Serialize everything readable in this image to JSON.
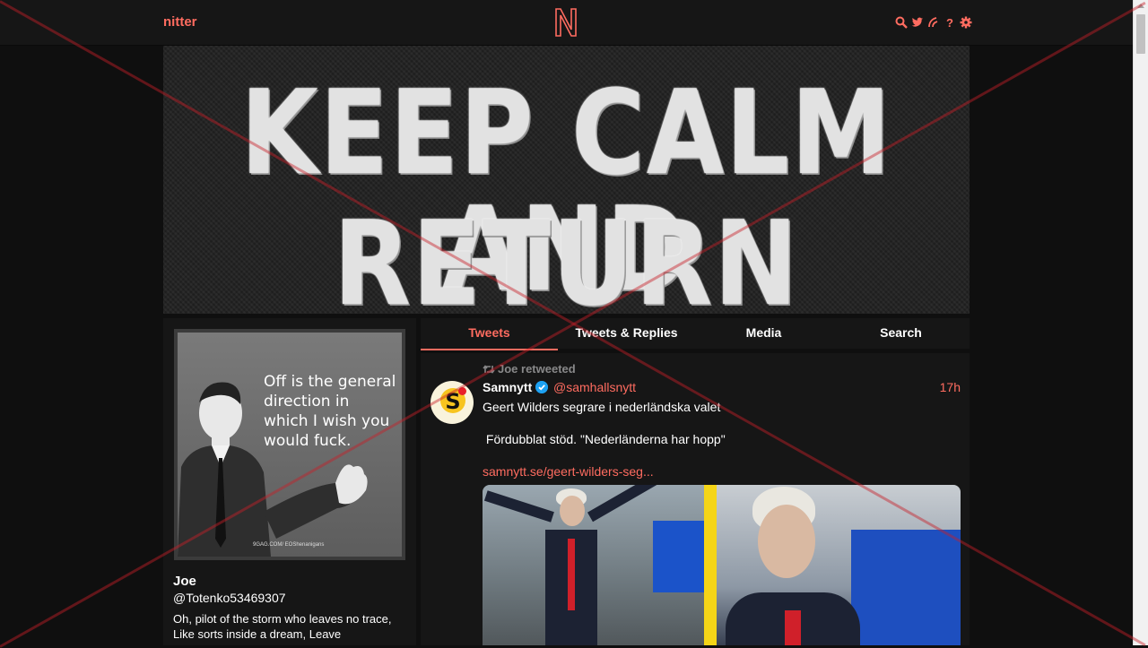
{
  "navbar": {
    "brand": "nitter",
    "logo_letter": "N",
    "icons": [
      "search-icon",
      "twitter-icon",
      "rss-icon",
      "help-icon",
      "settings-icon"
    ]
  },
  "banner": {
    "line1": "KEEP CALM AND",
    "line2": "RETURN FIRE"
  },
  "profile": {
    "avatar_caption": "Off is the general direction in which I wish you would fuck.",
    "avatar_watermark": "9GAG.COM/ EOShenanigans",
    "fullname": "Joe",
    "username": "@Totenko53469307",
    "bio": "Oh, pilot of the storm who leaves no trace, Like sorts inside a dream, Leave"
  },
  "tabs": [
    {
      "label": "Tweets",
      "active": true
    },
    {
      "label": "Tweets & Replies",
      "active": false
    },
    {
      "label": "Media",
      "active": false
    },
    {
      "label": "Search",
      "active": false
    }
  ],
  "tweet": {
    "retweet_header": "Joe retweeted",
    "fullname": "Samnytt",
    "username": "@samhallsnytt",
    "time": "17h",
    "text_line1": "Geert Wilders segrare i nederländska valet",
    "text_line2": " Fördubblat stöd. \"Nederländerna har hopp\"",
    "link": "samnytt.se/geert-wilders-seg..."
  },
  "colors": {
    "accent": "#ff6c60",
    "background": "#0f0f0f",
    "panel": "#161616",
    "verified": "#1da1f2"
  }
}
